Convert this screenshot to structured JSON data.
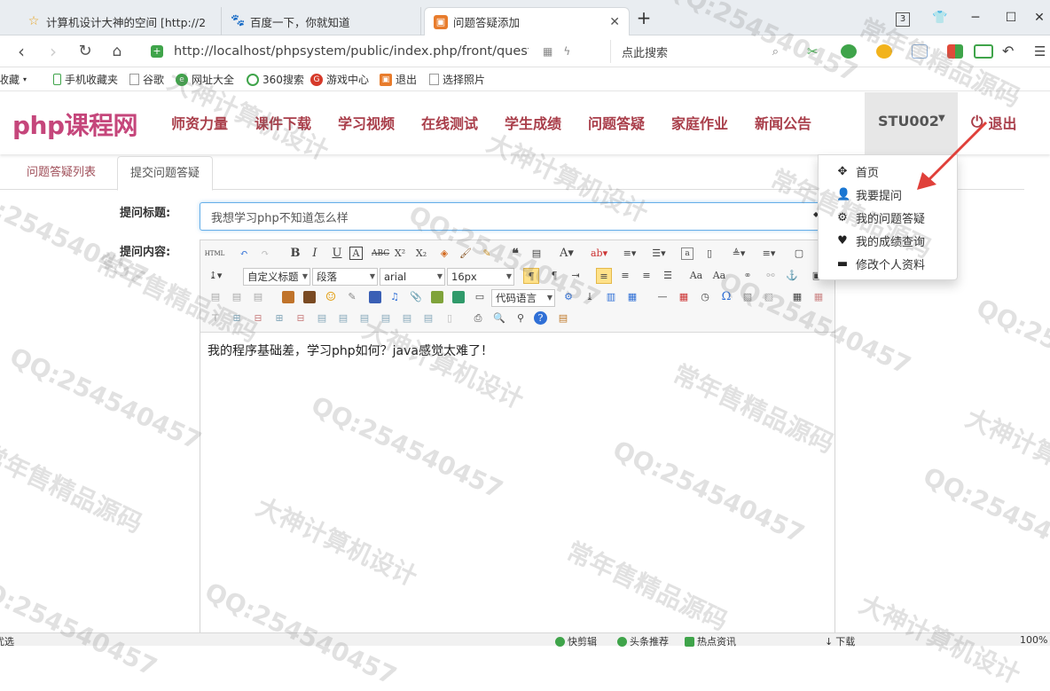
{
  "browser": {
    "tabs": [
      {
        "title": "计算机设计大神的空间 [http://2",
        "icon": "star-icon"
      },
      {
        "title": "百度一下，你就知道",
        "icon": "paw-icon"
      },
      {
        "title": "问题答疑添加",
        "icon": "page-icon"
      }
    ],
    "tab_badge": "3",
    "new_tab": "+",
    "url": "http://localhost/phpsystem/public/index.php/front/questic",
    "search_placeholder": "点此搜索",
    "favorites": [
      "收藏",
      "手机收藏夹",
      "谷歌",
      "网址大全",
      "360搜索",
      "游戏中心",
      "退出",
      "选择照片"
    ]
  },
  "site": {
    "logo": "php课程网",
    "nav": [
      "师资力量",
      "课件下载",
      "学习视频",
      "在线测试",
      "学生成绩",
      "问题答疑",
      "家庭作业",
      "新闻公告"
    ],
    "user": "STU002",
    "logout": "退出",
    "dropdown": [
      {
        "label": "首页",
        "icon": "move-icon"
      },
      {
        "label": "我要提问",
        "icon": "user-icon"
      },
      {
        "label": "我的问题答疑",
        "icon": "gear-icon"
      },
      {
        "label": "我的成绩查询",
        "icon": "heart-icon"
      },
      {
        "label": "修改个人资料",
        "icon": "card-icon"
      }
    ]
  },
  "page": {
    "tabs": [
      "问题答疑列表",
      "提交问题答疑"
    ],
    "active_tab": "提交问题答疑",
    "title_label": "提问标题:",
    "title_value": "我想学习php不知道怎么样",
    "content_label": "提问内容:",
    "content_value": "我的程序基础差，学习php如何？java感觉太难了！"
  },
  "editor": {
    "selects": [
      "自定义标题",
      "段落",
      "arial",
      "16px",
      "代码语言"
    ]
  },
  "statusbar": {
    "left": "优选",
    "items": [
      "快剪辑",
      "头条推荐",
      "热点资讯",
      "下载"
    ],
    "zoom": "100%"
  },
  "watermark": [
    "常年售精品源码",
    "大神计算机设计",
    "QQ:254540457"
  ],
  "colors": {
    "accent": "#a93e4a",
    "logo": "#c5467b",
    "arrow": "#e0403a"
  }
}
